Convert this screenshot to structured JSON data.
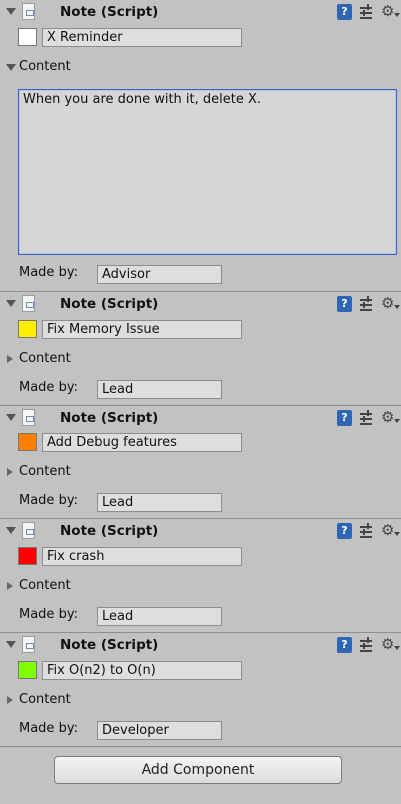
{
  "components": [
    {
      "title": "Note (Script)",
      "color": "#ffffff",
      "name_value": "X Reminder",
      "content_label": "Content",
      "content_expanded": true,
      "content_text": "When you are done with it, delete X.",
      "made_by_label": "Made by:",
      "made_by_value": "Advisor"
    },
    {
      "title": "Note (Script)",
      "color": "#ffee00",
      "name_value": "Fix Memory Issue",
      "content_label": "Content",
      "content_expanded": false,
      "made_by_label": "Made by:",
      "made_by_value": "Lead"
    },
    {
      "title": "Note (Script)",
      "color": "#ff8000",
      "name_value": "Add Debug features",
      "content_label": "Content",
      "content_expanded": false,
      "made_by_label": "Made by:",
      "made_by_value": "Lead"
    },
    {
      "title": "Note (Script)",
      "color": "#ff0000",
      "name_value": "Fix crash",
      "content_label": "Content",
      "content_expanded": false,
      "made_by_label": "Made by:",
      "made_by_value": "Lead"
    },
    {
      "title": "Note (Script)",
      "color": "#80ff00",
      "name_value": "Fix O(n2) to O(n)",
      "content_label": "Content",
      "content_expanded": false,
      "made_by_label": "Made by:",
      "made_by_value": "Developer"
    }
  ],
  "help_icon_glyph": "?",
  "gear_icon_glyph": "⚙",
  "add_component_label": "Add Component"
}
